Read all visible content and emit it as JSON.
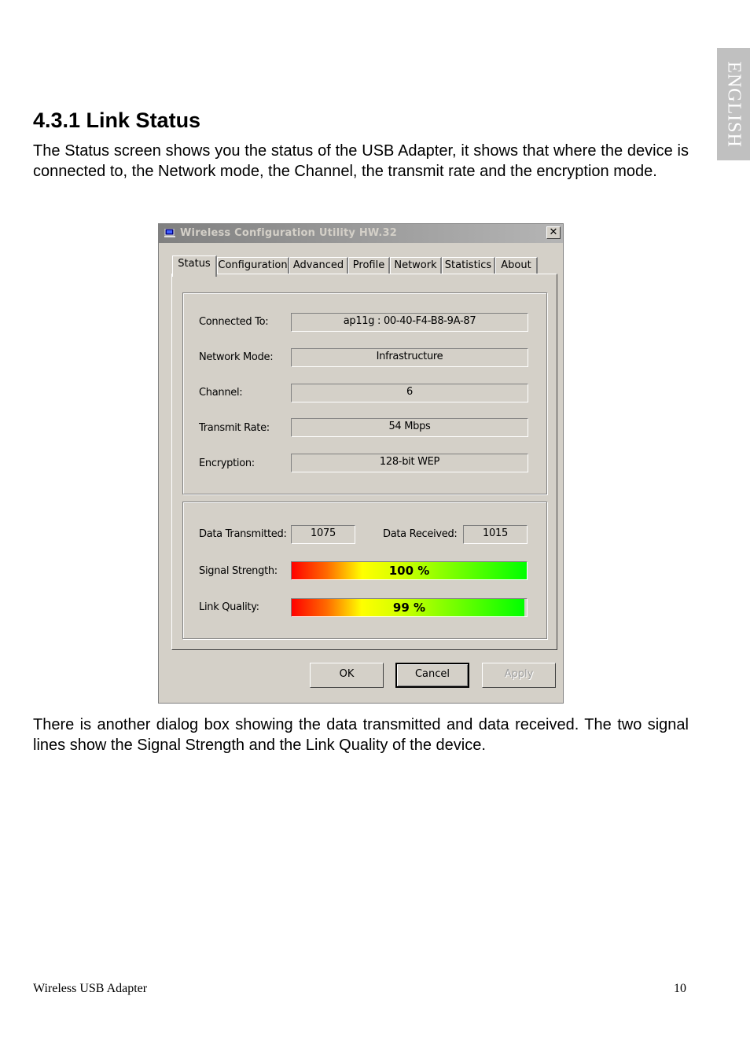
{
  "side_tab": {
    "label": "ENGLISH"
  },
  "section": {
    "heading": "4.3.1 Link Status",
    "intro": "The Status screen shows you the status of the USB Adapter, it shows that where the device is connected to, the Network mode, the Channel, the transmit rate and the encryption mode.",
    "outro": "There is another dialog box showing the data transmitted and data received. The two signal lines show the Signal Strength and the Link Quality of the device."
  },
  "dialog": {
    "title": "Wireless Configuration Utility HW.32",
    "icon": "network-adapter-icon",
    "close_label": "✕",
    "tabs": [
      {
        "label": "Status",
        "active": true
      },
      {
        "label": "Configuration",
        "active": false
      },
      {
        "label": "Advanced",
        "active": false
      },
      {
        "label": "Profile",
        "active": false
      },
      {
        "label": "Network",
        "active": false
      },
      {
        "label": "Statistics",
        "active": false
      },
      {
        "label": "About",
        "active": false
      }
    ],
    "status_fields": [
      {
        "label": "Connected To:",
        "value": "ap11g : 00-40-F4-B8-9A-87"
      },
      {
        "label": "Network Mode:",
        "value": "Infrastructure"
      },
      {
        "label": "Channel:",
        "value": "6"
      },
      {
        "label": "Transmit Rate:",
        "value": "54 Mbps"
      },
      {
        "label": "Encryption:",
        "value": "128-bit WEP"
      }
    ],
    "traffic": {
      "transmitted_label": "Data Transmitted:",
      "transmitted_value": "1075",
      "received_label": "Data Received:",
      "received_value": "1015"
    },
    "signal_strength": {
      "label": "Signal Strength:",
      "text": "100 %",
      "percent": 100
    },
    "link_quality": {
      "label": "Link Quality:",
      "text": "99 %",
      "percent": 99
    },
    "buttons": {
      "ok": "OK",
      "cancel": "Cancel",
      "apply": "Apply"
    }
  },
  "footer": {
    "title": "Wireless USB Adapter",
    "page_number": "10"
  }
}
